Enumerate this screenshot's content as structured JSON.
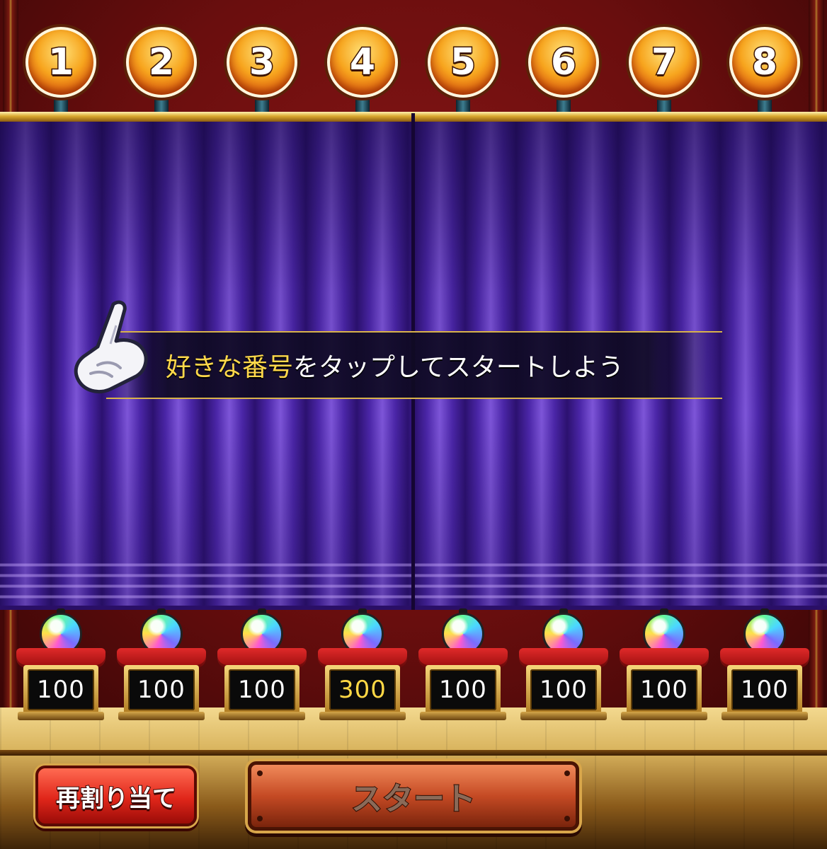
{
  "number_balls": [
    "1",
    "2",
    "3",
    "4",
    "5",
    "6",
    "7",
    "8"
  ],
  "instruction": {
    "highlight": "好きな番号",
    "rest": "をタップしてスタートしよう"
  },
  "prizes": [
    {
      "value": "100",
      "highlight": false
    },
    {
      "value": "100",
      "highlight": false
    },
    {
      "value": "100",
      "highlight": false
    },
    {
      "value": "300",
      "highlight": true
    },
    {
      "value": "100",
      "highlight": false
    },
    {
      "value": "100",
      "highlight": false
    },
    {
      "value": "100",
      "highlight": false
    },
    {
      "value": "100",
      "highlight": false
    }
  ],
  "buttons": {
    "reassign_label": "再割り当て",
    "start_label": "スタート",
    "start_enabled": false
  },
  "colors": {
    "accent_gold": "#ffd94a",
    "curtain_purple": "#4b26a8",
    "ball_orange": "#f7a51e"
  }
}
